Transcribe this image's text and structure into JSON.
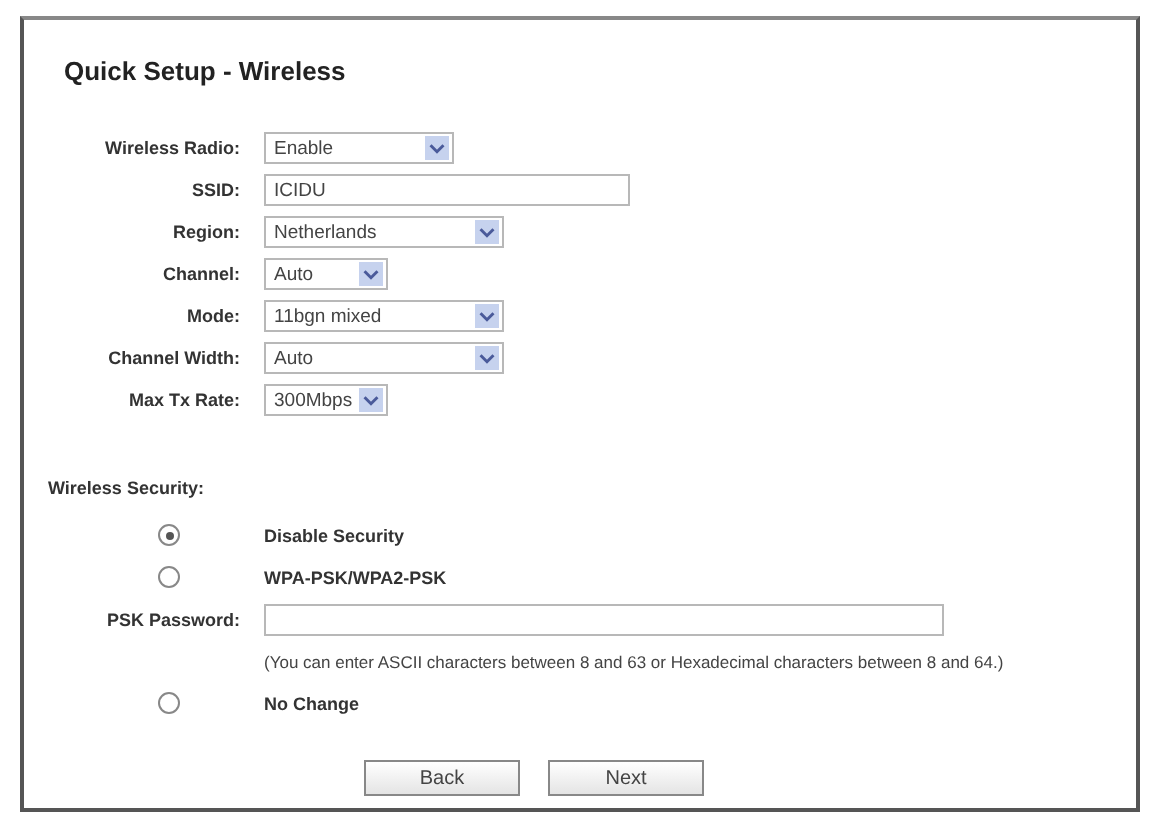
{
  "title": "Quick Setup - Wireless",
  "fields": [
    {
      "label": "Wireless Radio:",
      "kind": "select",
      "value": "Enable"
    },
    {
      "label": "SSID:",
      "kind": "text",
      "value": "ICIDU"
    },
    {
      "label": "Region:",
      "kind": "select",
      "value": "Netherlands"
    },
    {
      "label": "Channel:",
      "kind": "select",
      "value": "Auto"
    },
    {
      "label": "Mode:",
      "kind": "select",
      "value": "11bgn mixed"
    },
    {
      "label": "Channel Width:",
      "kind": "select",
      "value": "Auto"
    },
    {
      "label": "Max Tx Rate:",
      "kind": "select",
      "value": "300Mbps"
    }
  ],
  "security": {
    "heading": "Wireless Security:",
    "options": [
      {
        "label": "Disable Security",
        "selected": true
      },
      {
        "label": "WPA-PSK/WPA2-PSK",
        "selected": false
      }
    ],
    "psk_label": "PSK Password:",
    "psk_hint": "(You can enter ASCII characters between 8 and 63 or Hexadecimal characters between 8 and 64.)",
    "no_change": {
      "label": "No Change",
      "selected": false
    }
  },
  "buttons": [
    "Back",
    "Next"
  ]
}
